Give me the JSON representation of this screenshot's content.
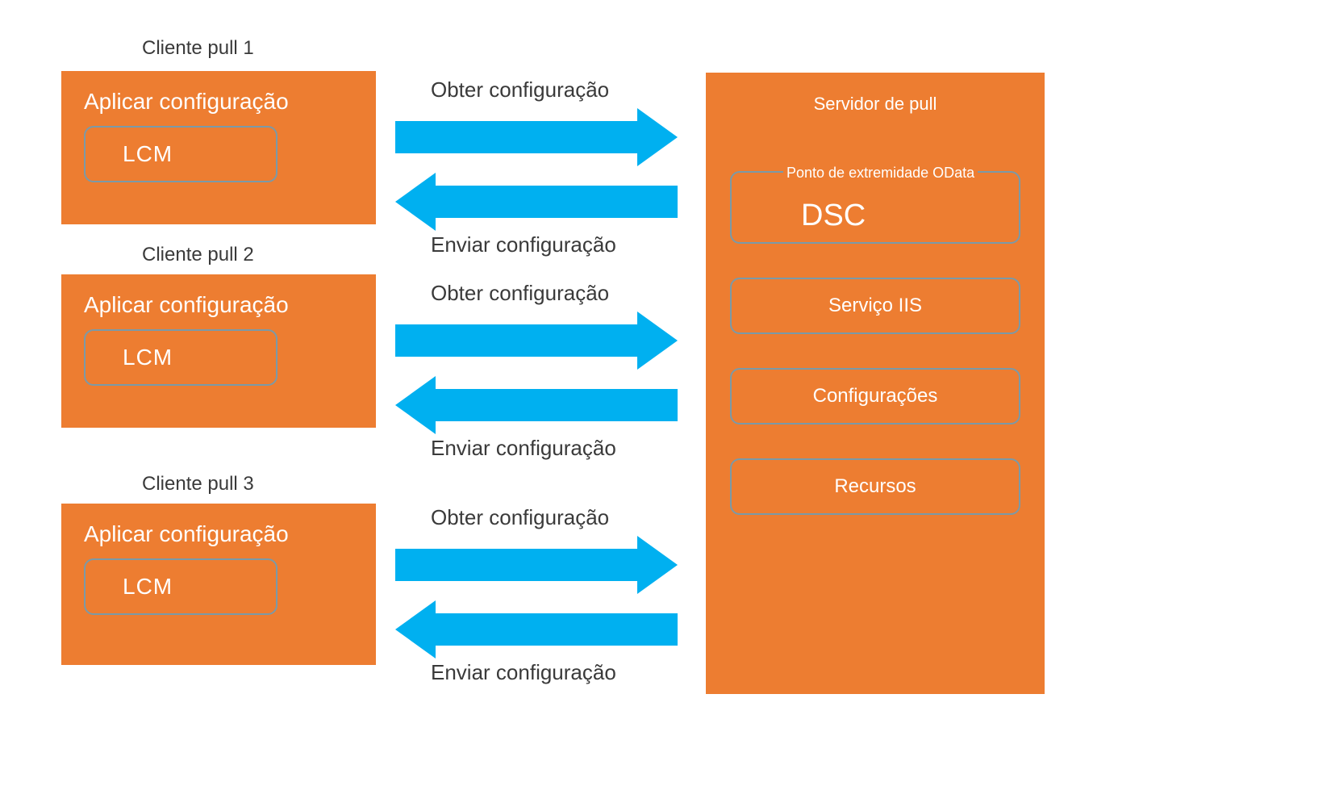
{
  "clients": [
    {
      "label": "Cliente pull 1",
      "title": "Aplicar configuração",
      "lcm": "LCM"
    },
    {
      "label": "Cliente pull 2",
      "title": "Aplicar configuração",
      "lcm": "LCM"
    },
    {
      "label": "Cliente pull 3",
      "title": "Aplicar configuração",
      "lcm": "LCM"
    }
  ],
  "arrows": {
    "top": "Obter configuração",
    "bottom": "Enviar configuração"
  },
  "server": {
    "title": "Servidor de pull",
    "odata_label": "Ponto de extremidade OData",
    "odata_title": "DSC",
    "items": [
      "Serviço IIS",
      "Configurações",
      "Recursos"
    ]
  },
  "colors": {
    "box": "#ed7d31",
    "arrow": "#00b0f0",
    "border": "#7a9aa8"
  }
}
